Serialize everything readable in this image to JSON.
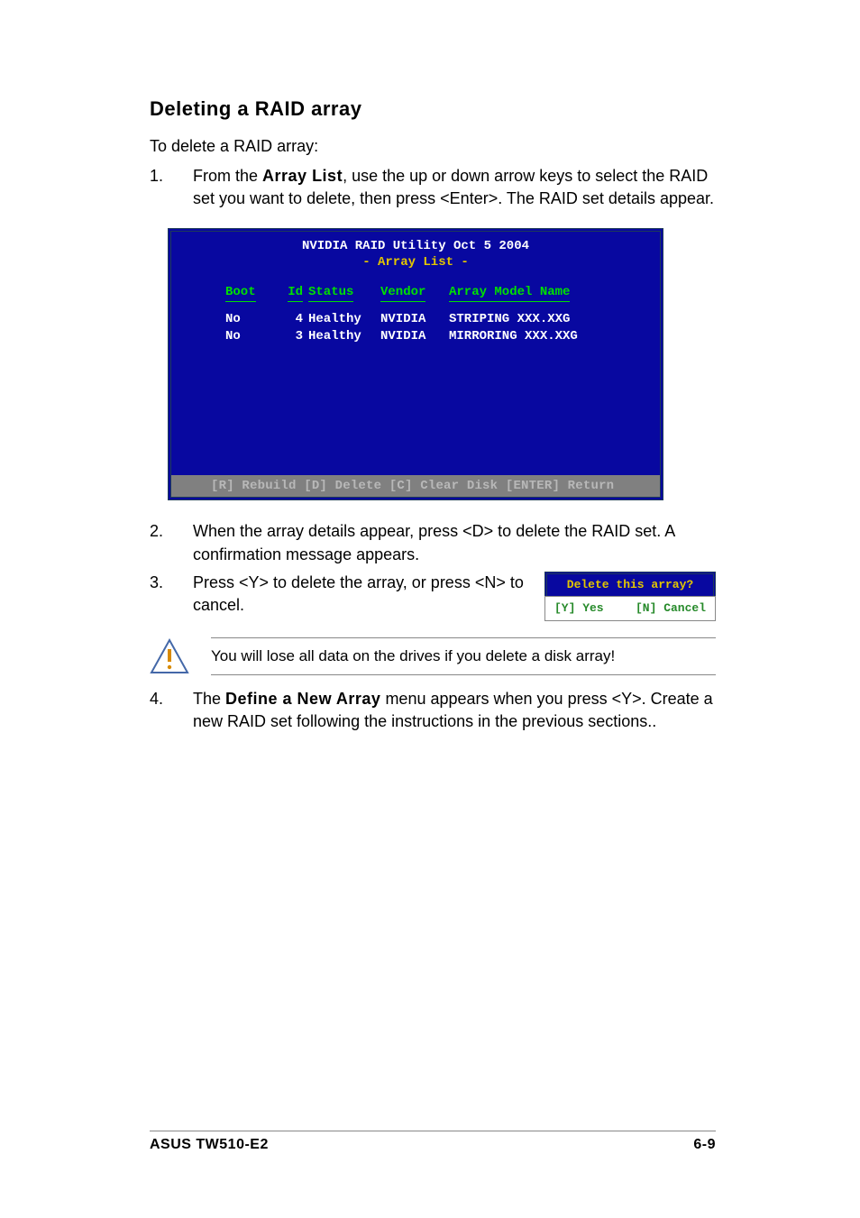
{
  "heading": "Deleting a RAID array",
  "intro": "To delete a RAID array:",
  "steps": {
    "s1": {
      "num": "1.",
      "pre": "From the ",
      "bold": "Array List",
      "post": ", use the up or down arrow keys to select the RAID set you want to delete, then press <Enter>. The RAID set details appear."
    },
    "s2": {
      "num": "2.",
      "text": "When the array details appear, press <D> to delete the RAID set. A confirmation message appears."
    },
    "s3": {
      "num": "3.",
      "text": "Press <Y> to delete the array, or press <N> to cancel."
    },
    "s4": {
      "num": "4.",
      "pre": "The ",
      "bold": "Define a New Array",
      "post": " menu appears when you press <Y>. Create a new RAID set following the instructions in the previous sections.."
    }
  },
  "bios": {
    "title": "NVIDIA RAID Utility  Oct 5 2004",
    "subtitle": "- Array List -",
    "head": {
      "boot": "Boot",
      "id": "Id",
      "status": "Status",
      "vendor": "Vendor",
      "model": "Array Model Name"
    },
    "rows": [
      {
        "boot": "No",
        "id": "4",
        "status": "Healthy",
        "vendor": "NVIDIA",
        "model": "STRIPING  XXX.XXG"
      },
      {
        "boot": "No",
        "id": "3",
        "status": "Healthy",
        "vendor": "NVIDIA",
        "model": "MIRRORING XXX.XXG"
      }
    ],
    "hint": "[R] Rebuild  [D] Delete  [C] Clear Disk  [ENTER] Return"
  },
  "dialog": {
    "head": "Delete this array?",
    "yes": "[Y] Yes",
    "no": "[N] Cancel"
  },
  "note": "You will lose all data on the drives if you delete a disk array!",
  "footer": {
    "left": "ASUS TW510-E2",
    "right": "6-9"
  }
}
